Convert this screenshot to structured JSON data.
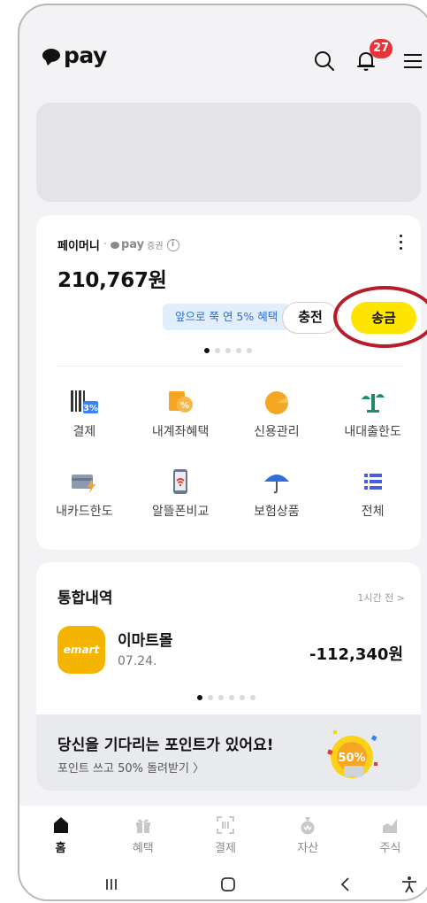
{
  "header": {
    "logo_text": "pay",
    "notification_count": "27"
  },
  "money": {
    "label": "페이머니",
    "sep": "·",
    "brand": "pay",
    "brand_suffix": "증권",
    "info": "i",
    "balance": "210,767원",
    "benefit_chip": "앞으로 쭉 연 5% 혜택",
    "charge_label": "충전",
    "send_label": "송금",
    "menu": [
      {
        "label": "결제",
        "icon": "barcode-3-percent-icon"
      },
      {
        "label": "내계좌혜택",
        "icon": "account-coin-icon"
      },
      {
        "label": "신용관리",
        "icon": "credit-gauge-icon"
      },
      {
        "label": "내대출한도",
        "icon": "scale-icon"
      },
      {
        "label": "내카드한도",
        "icon": "card-bolt-icon"
      },
      {
        "label": "알뜰폰비교",
        "icon": "phone-signal-icon"
      },
      {
        "label": "보험상품",
        "icon": "umbrella-icon"
      },
      {
        "label": "전체",
        "icon": "list-icon"
      }
    ]
  },
  "history": {
    "title": "통합내역",
    "time": "1시간 전 >",
    "merchant_logo": "emart",
    "merchant": "이마트몰",
    "date": "07.24.",
    "amount": "-112,340원"
  },
  "promo": {
    "title": "당신을 기다리는 포인트가 있어요!",
    "subtitle": "포인트 쓰고 50% 돌려받기 〉",
    "coin_text": "50%"
  },
  "tabs": [
    {
      "label": "홈",
      "icon": "home-icon"
    },
    {
      "label": "혜택",
      "icon": "gift-icon"
    },
    {
      "label": "결제",
      "icon": "scan-icon"
    },
    {
      "label": "자산",
      "icon": "money-bag-icon"
    },
    {
      "label": "주식",
      "icon": "chart-icon"
    }
  ],
  "colors": {
    "accent_yellow": "#fee500",
    "badge_red": "#e8333a",
    "ring_red": "#b71c2a",
    "chip_blue": "#2a6fd6"
  }
}
